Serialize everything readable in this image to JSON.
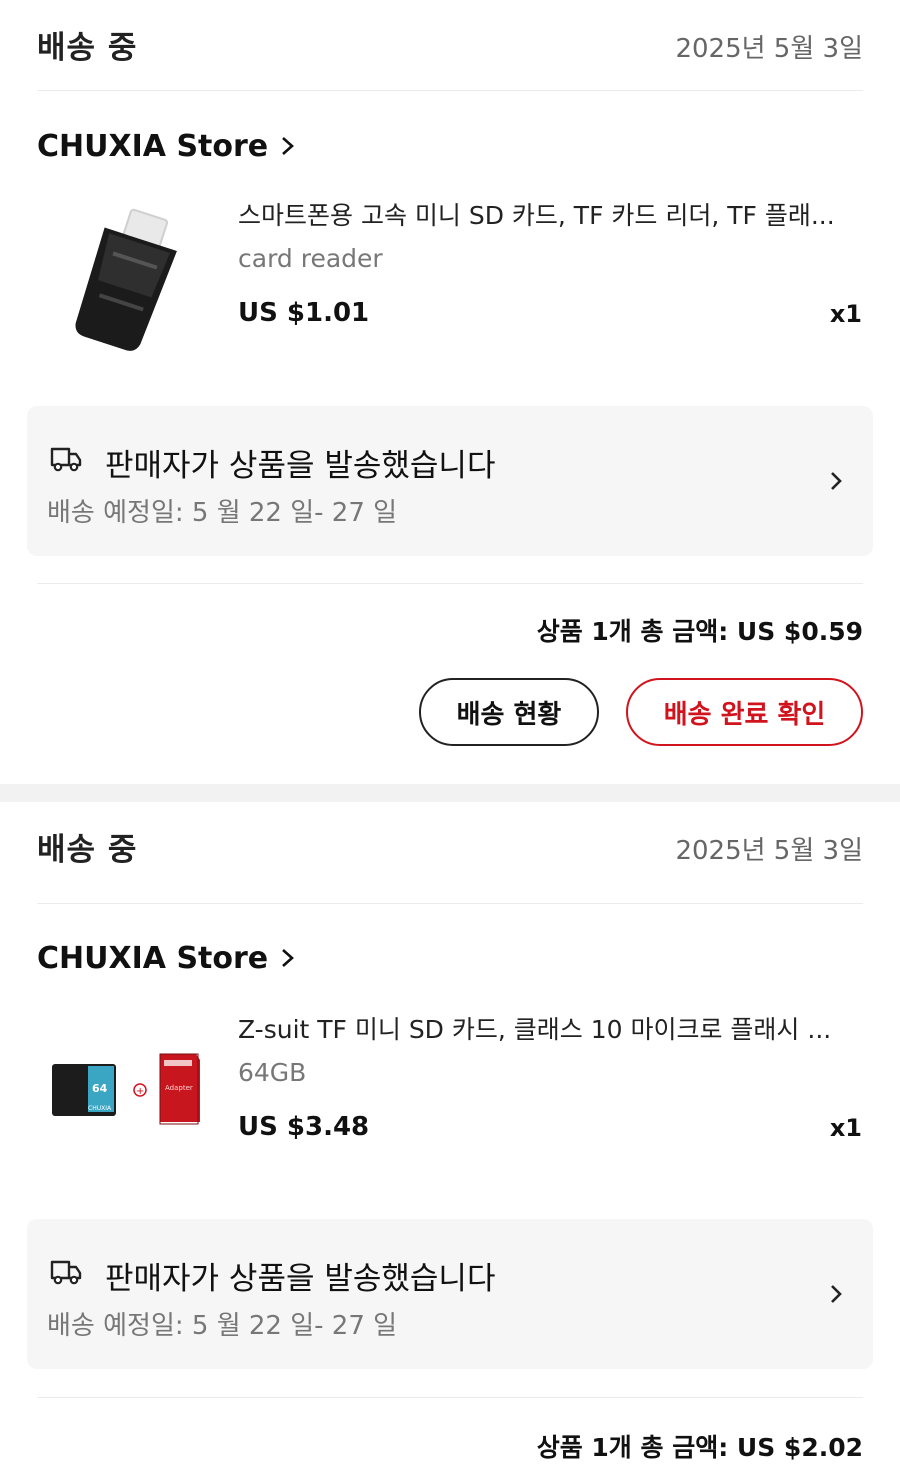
{
  "orders": [
    {
      "status": "배송 중",
      "date": "2025년 5월 3일",
      "store": "CHUXIA Store",
      "product_title": "스마트폰용 고속 미니 SD 카드, TF 카드 리더, TF 플래...",
      "variant": "card reader",
      "price": "US $1.01",
      "quantity": "x1",
      "shipping_status": "판매자가 상품을 발송했습니다",
      "delivery_estimate": "배송 예정일: 5 월 22 일- 27 일",
      "total": "상품 1개 총 금액: US $0.59",
      "track_label": "배송 현황",
      "confirm_label": "배송 완료 확인",
      "thumbnail_icon": "card-reader-image"
    },
    {
      "status": "배송 중",
      "date": "2025년 5월 3일",
      "store": "CHUXIA Store",
      "product_title": "Z-suit TF 미니 SD 카드, 클래스 10 마이크로 플래시 ...",
      "variant": "64GB",
      "price": "US $3.48",
      "quantity": "x1",
      "shipping_status": "판매자가 상품을 발송했습니다",
      "delivery_estimate": "배송 예정일: 5 월 22 일- 27 일",
      "total": "상품 1개 총 금액: US $2.02",
      "thumbnail_icon": "sd-card-with-adapter-image",
      "thumbnail_text": {
        "card_capacity": "64",
        "card_brand": "CHUXIA",
        "adapter_label": "Adapter"
      }
    }
  ],
  "colors": {
    "accent": "#d1131d",
    "muted_text": "#777777",
    "box_bg": "#f6f6f6",
    "section_gap": "#f2f2f2"
  }
}
